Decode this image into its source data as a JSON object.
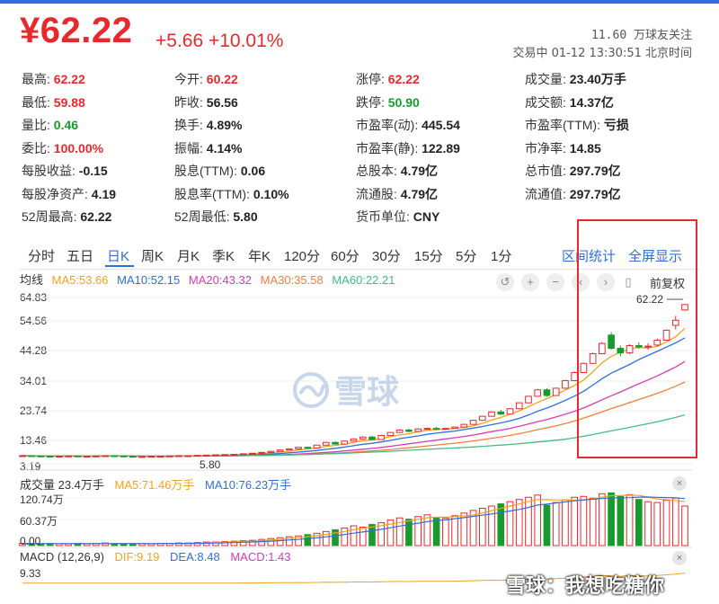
{
  "quote": {
    "price": "¥62.22",
    "change": "+5.66 +10.01%",
    "followers": "11.60 万球友关注",
    "timestamp": "交易中 01-12 13:30:51 北京时间"
  },
  "stats": [
    [
      {
        "label": "最高:",
        "value": "62.22",
        "color": "red"
      },
      {
        "label": "今开:",
        "value": "60.22",
        "color": "red"
      },
      {
        "label": "涨停:",
        "value": "62.22",
        "color": "red"
      },
      {
        "label": "成交量:",
        "value": "23.40万手",
        "color": ""
      }
    ],
    [
      {
        "label": "最低:",
        "value": "59.88",
        "color": "red"
      },
      {
        "label": "昨收:",
        "value": "56.56",
        "color": ""
      },
      {
        "label": "跌停:",
        "value": "50.90",
        "color": "green"
      },
      {
        "label": "成交额:",
        "value": "14.37亿",
        "color": ""
      }
    ],
    [
      {
        "label": "量比:",
        "value": "0.46",
        "color": "green"
      },
      {
        "label": "换手:",
        "value": "4.89%",
        "color": ""
      },
      {
        "label": "市盈率(动):",
        "value": "445.54",
        "color": ""
      },
      {
        "label": "市盈率(TTM):",
        "value": "亏损",
        "color": ""
      }
    ],
    [
      {
        "label": "委比:",
        "value": "100.00%",
        "color": "red"
      },
      {
        "label": "振幅:",
        "value": "4.14%",
        "color": ""
      },
      {
        "label": "市盈率(静):",
        "value": "122.89",
        "color": ""
      },
      {
        "label": "市净率:",
        "value": "14.85",
        "color": ""
      }
    ],
    [
      {
        "label": "每股收益:",
        "value": "-0.15",
        "color": ""
      },
      {
        "label": "股息(TTM):",
        "value": "0.06",
        "color": ""
      },
      {
        "label": "总股本:",
        "value": "4.79亿",
        "color": ""
      },
      {
        "label": "总市值:",
        "value": "297.79亿",
        "color": ""
      }
    ],
    [
      {
        "label": "每股净资产:",
        "value": "4.19",
        "color": ""
      },
      {
        "label": "股息率(TTM):",
        "value": "0.10%",
        "color": ""
      },
      {
        "label": "流通股:",
        "value": "4.79亿",
        "color": ""
      },
      {
        "label": "流通值:",
        "value": "297.79亿",
        "color": ""
      }
    ],
    [
      {
        "label": "52周最高:",
        "value": "62.22",
        "color": ""
      },
      {
        "label": "52周最低:",
        "value": "5.80",
        "color": ""
      },
      {
        "label": "货币单位:",
        "value": "CNY",
        "color": ""
      }
    ]
  ],
  "tabs": {
    "items": [
      "分时",
      "五日",
      "日K",
      "周K",
      "月K",
      "季K",
      "年K",
      "120分",
      "60分",
      "30分",
      "15分",
      "5分",
      "1分"
    ],
    "active": "日K",
    "right": [
      "区间统计",
      "全屏显示"
    ]
  },
  "ma": {
    "label": "均线",
    "items": [
      {
        "text": "MA5:53.66",
        "color": "#f2a31b"
      },
      {
        "text": "MA10:52.15",
        "color": "#2f6fdc"
      },
      {
        "text": "MA20:43.32",
        "color": "#d63bb8"
      },
      {
        "text": "MA30:35.58",
        "color": "#f07f3c"
      },
      {
        "text": "MA60:22.21",
        "color": "#3fbf7f"
      }
    ]
  },
  "controls": {
    "icons": [
      "undo-icon",
      "zoom-in-icon",
      "zoom-out-icon",
      "scroll-left-icon",
      "scroll-right-icon",
      "drag-handle-icon"
    ],
    "adjust": "前复权"
  },
  "price_axis": [
    "64.83",
    "54.56",
    "44.28",
    "34.01",
    "23.74",
    "13.46",
    "3.19"
  ],
  "markers": {
    "high": "62.22",
    "low": "5.80"
  },
  "volume": {
    "title": "成交量 23.4万手",
    "ma5": "MA5:71.46万手",
    "ma10": "MA10:76.23万手",
    "axis": [
      "120.74万",
      "60.37万",
      "0.00"
    ]
  },
  "macd": {
    "title": "MACD (12,26,9)",
    "dif": "DIF:9.19",
    "dea": "DEA:8.48",
    "macd": "MACD:1.43",
    "axis_top": "9.33"
  },
  "watermark_logo": "雪球",
  "footer_watermark": "雪球：我想吃糖你",
  "colors": {
    "up": "#e8292b",
    "down": "#1a9a2c",
    "accent": "#2f6fdc"
  },
  "chart_data": {
    "type": "candlestick",
    "ylim": [
      3.19,
      64.83
    ],
    "candles": [
      [
        6.0,
        6.3,
        5.9,
        6.2
      ],
      [
        6.2,
        6.3,
        6.0,
        6.1
      ],
      [
        6.1,
        6.2,
        5.9,
        6.0
      ],
      [
        6.0,
        6.1,
        5.8,
        5.9
      ],
      [
        5.9,
        6.1,
        5.8,
        6.0
      ],
      [
        6.0,
        6.2,
        5.9,
        6.1
      ],
      [
        6.1,
        6.2,
        5.9,
        6.0
      ],
      [
        6.0,
        6.1,
        5.9,
        6.0
      ],
      [
        6.0,
        6.2,
        5.9,
        6.1
      ],
      [
        6.1,
        6.3,
        6.0,
        6.2
      ],
      [
        6.2,
        6.3,
        6.0,
        6.1
      ],
      [
        6.1,
        6.2,
        5.9,
        6.0
      ],
      [
        6.0,
        6.1,
        5.8,
        5.9
      ],
      [
        5.9,
        6.0,
        5.8,
        5.9
      ],
      [
        5.9,
        6.1,
        5.8,
        6.0
      ],
      [
        6.0,
        6.1,
        5.9,
        6.0
      ],
      [
        6.0,
        6.2,
        5.9,
        6.1
      ],
      [
        6.1,
        6.3,
        6.0,
        6.2
      ],
      [
        6.2,
        6.3,
        6.1,
        6.2
      ],
      [
        6.2,
        6.4,
        6.1,
        6.3
      ],
      [
        6.3,
        6.5,
        6.2,
        6.4
      ],
      [
        6.4,
        6.6,
        6.3,
        6.5
      ],
      [
        6.5,
        6.7,
        6.4,
        6.6
      ],
      [
        6.6,
        6.8,
        6.5,
        6.7
      ],
      [
        6.7,
        7.0,
        6.6,
        6.9
      ],
      [
        6.9,
        7.2,
        6.8,
        7.1
      ],
      [
        7.1,
        7.5,
        7.0,
        7.4
      ],
      [
        7.4,
        7.9,
        7.3,
        7.8
      ],
      [
        7.8,
        8.4,
        7.7,
        8.3
      ],
      [
        8.3,
        8.9,
        8.2,
        8.7
      ],
      [
        8.7,
        9.4,
        8.6,
        9.3
      ],
      [
        9.3,
        9.6,
        8.8,
        9.0
      ],
      [
        9.0,
        10.2,
        8.9,
        10.1
      ],
      [
        10.1,
        11.3,
        10.0,
        11.1
      ],
      [
        11.1,
        11.5,
        10.3,
        10.5
      ],
      [
        10.5,
        11.8,
        10.4,
        11.6
      ],
      [
        11.6,
        12.6,
        11.5,
        12.4
      ],
      [
        12.4,
        13.3,
        12.3,
        13.1
      ],
      [
        13.1,
        13.6,
        12.0,
        12.2
      ],
      [
        12.2,
        13.9,
        12.1,
        13.7
      ],
      [
        13.7,
        15.0,
        13.6,
        14.8
      ],
      [
        14.8,
        16.0,
        14.6,
        15.7
      ],
      [
        15.7,
        16.2,
        14.9,
        15.2
      ],
      [
        15.2,
        16.4,
        15.1,
        16.1
      ],
      [
        16.1,
        16.6,
        15.9,
        16.3
      ],
      [
        16.3,
        16.8,
        15.9,
        16.0
      ],
      [
        16.0,
        16.5,
        15.8,
        16.3
      ],
      [
        16.3,
        17.0,
        16.1,
        16.8
      ],
      [
        16.8,
        18.0,
        16.7,
        17.8
      ],
      [
        17.8,
        19.5,
        17.6,
        19.3
      ],
      [
        19.3,
        21.0,
        19.1,
        20.8
      ],
      [
        20.8,
        22.6,
        20.6,
        22.4
      ],
      [
        22.4,
        23.2,
        21.3,
        21.6
      ],
      [
        21.6,
        23.8,
        21.5,
        23.6
      ],
      [
        23.6,
        26.0,
        23.4,
        25.8
      ],
      [
        25.8,
        28.4,
        25.6,
        28.2
      ],
      [
        28.2,
        31.0,
        28.0,
        30.6
      ],
      [
        30.6,
        31.2,
        28.0,
        28.5
      ],
      [
        28.5,
        31.4,
        28.3,
        31.2
      ],
      [
        31.2,
        34.3,
        31.0,
        34.0
      ],
      [
        34.0,
        37.4,
        33.8,
        37.0
      ],
      [
        37.0,
        40.7,
        36.8,
        40.4
      ],
      [
        40.4,
        44.4,
        40.2,
        44.0
      ],
      [
        44.0,
        48.3,
        43.8,
        47.8
      ],
      [
        50.9,
        52.0,
        45.5,
        46.0
      ],
      [
        46.0,
        47.0,
        43.0,
        44.3
      ],
      [
        44.3,
        47.5,
        43.8,
        47.0
      ],
      [
        47.0,
        48.2,
        45.8,
        46.5
      ],
      [
        46.5,
        47.9,
        45.5,
        46.8
      ],
      [
        47.2,
        49.6,
        46.6,
        49.0
      ],
      [
        49.0,
        53.0,
        48.8,
        52.7
      ],
      [
        54.5,
        58.0,
        53.0,
        56.4
      ],
      [
        60.2,
        62.22,
        59.88,
        62.22
      ]
    ],
    "volume_max": 120.74,
    "volume": [
      5,
      4,
      4,
      5,
      4,
      4,
      5,
      4,
      5,
      6,
      5,
      4,
      4,
      5,
      4,
      5,
      5,
      6,
      6,
      7,
      8,
      8,
      9,
      10,
      11,
      12,
      14,
      16,
      18,
      20,
      22,
      25,
      28,
      32,
      36,
      40,
      45,
      42,
      48,
      52,
      58,
      63,
      60,
      66,
      70,
      64,
      62,
      68,
      74,
      80,
      85,
      90,
      95,
      100,
      105,
      110,
      115,
      92,
      98,
      104,
      110,
      112,
      108,
      118,
      120,
      112,
      116,
      105,
      100,
      98,
      103,
      108,
      90
    ],
    "volume_up": [
      1,
      0,
      0,
      0,
      1,
      1,
      0,
      1,
      1,
      1,
      0,
      0,
      0,
      1,
      1,
      1,
      1,
      1,
      1,
      1,
      1,
      1,
      1,
      1,
      1,
      1,
      1,
      1,
      1,
      1,
      1,
      0,
      1,
      1,
      0,
      1,
      1,
      1,
      0,
      1,
      1,
      1,
      0,
      1,
      1,
      0,
      1,
      1,
      1,
      1,
      1,
      1,
      0,
      1,
      1,
      1,
      1,
      0,
      1,
      1,
      1,
      1,
      1,
      1,
      0,
      0,
      1,
      0,
      1,
      1,
      1,
      1,
      1
    ]
  }
}
